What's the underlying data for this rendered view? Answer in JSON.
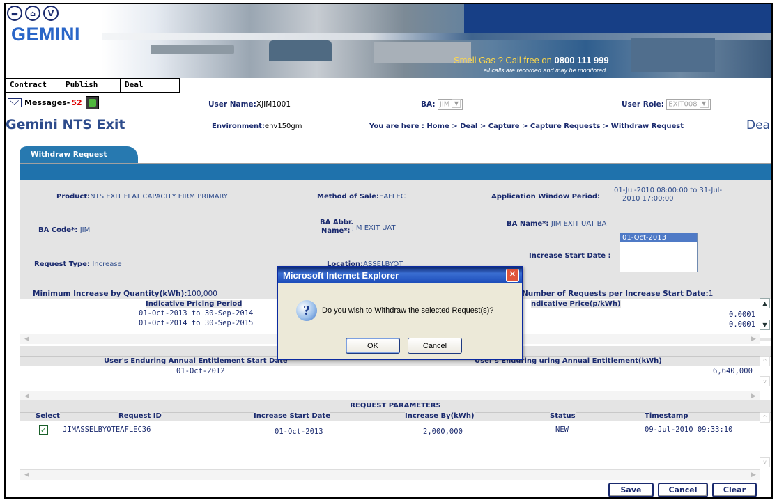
{
  "header": {
    "logo_text": "GEMINI",
    "nav_icon_v": "V",
    "banner_text_prefix": "Smell Gas ? Call free on ",
    "banner_phone": "0800 111 999",
    "banner_note": "all calls are recorded and may be monitored",
    "menu": [
      "Contract",
      "Publish",
      "Deal"
    ]
  },
  "status": {
    "messages_label": "Messages-",
    "messages_count": "52",
    "user_name_label": "User Name:",
    "user_name": "XJIM1001",
    "ba_label": "BA:",
    "ba_value": "JIM",
    "user_role_label": "User Role:",
    "user_role_value": "EXIT008"
  },
  "title_bar": {
    "title": "Gemini NTS Exit",
    "environment_label": "Environment:",
    "environment_value": "env150gm",
    "breadcrumb": "You are here : Home > Deal > Capture > Capture Requests > Withdraw Request",
    "section": "Deal"
  },
  "panel": {
    "tab": "Withdraw Request",
    "fields": {
      "product_label": "Product:",
      "product_value": "NTS EXIT FLAT CAPACITY FIRM PRIMARY",
      "method_label": "Method of Sale:",
      "method_value": "EAFLEC",
      "window_label": "Application Window Period:",
      "window_value_1": "01-Jul-2010 08:00:00 to 31-Jul-",
      "window_value_2": "2010 17:00:00",
      "ba_code_label": "BA Code*:",
      "ba_code_value": "JIM",
      "ba_abbr_label_1": "BA Abbr.",
      "ba_abbr_label_2": "Name*:",
      "ba_abbr_value": "JIM EXIT UAT",
      "ba_name_label": "BA Name*:",
      "ba_name_value": "JIM EXIT UAT BA",
      "request_type_label": "Request Type:",
      "request_type_value": "Increase",
      "location_label": "Location:",
      "location_value": "ASSELBYOT",
      "increase_start_label": "Increase Start Date :",
      "increase_start_selected": "01-Oct-2013"
    },
    "pricing": {
      "min_increase_label": "Minimum Increase by Quantity(kWh):",
      "min_increase_value": "100,000",
      "max_requests_label": "Number of Requests per Increase Start Date:",
      "max_requests_value": "1",
      "col_period": "Indicative Pricing Period",
      "col_price": "ndicative Price(p/kWh)",
      "rows": [
        {
          "period": "01-Oct-2013 to 30-Sep-2014",
          "price": "0.0001"
        },
        {
          "period": "01-Oct-2014 to 30-Sep-2015",
          "price": "0.0001"
        }
      ]
    },
    "entitlement": {
      "col_start": "User's Enduring Annual Entitlement Start",
      "col_start_tail": "Date",
      "col_value_head": "User's Enduring",
      "col_value_tail": "uring Annual Entitlement(kWh)",
      "start_date": "01-Oct-2012",
      "value": "6,640,000"
    },
    "requests": {
      "section_title": "REQUEST PARAMETERS",
      "columns": [
        "Select",
        "Request ID",
        "Increase Start Date",
        "Increase By(kWh)",
        "Status",
        "Timestamp"
      ],
      "rows": [
        {
          "request_id": "JIMASSELBYOTEAFLEC36",
          "start_date": "01-Oct-2013",
          "increase_by": "2,000,000",
          "status": "NEW",
          "timestamp": "09-Jul-2010 09:33:10",
          "checked": true
        }
      ]
    },
    "buttons": {
      "save": "Save",
      "cancel": "Cancel",
      "clear": "Clear"
    }
  },
  "dialog": {
    "title": "Microsoft Internet Explorer",
    "icon": "?",
    "message": "Do you wish to Withdraw the selected Request(s)?",
    "ok": "OK",
    "cancel": "Cancel"
  },
  "colors": {
    "header_blue": "#1f72ac",
    "text_navy": "#1a2a6e",
    "accent_red": "#d00000"
  }
}
